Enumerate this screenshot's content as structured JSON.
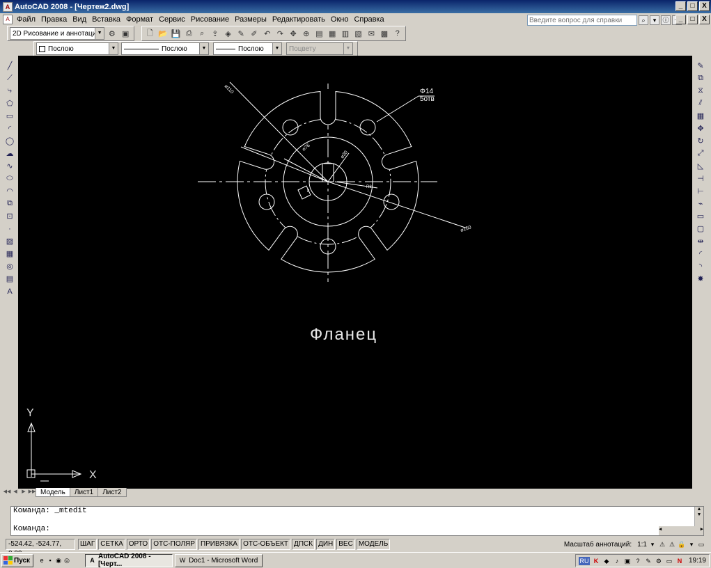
{
  "window": {
    "title": "AutoCAD 2008 - [Чертеж2.dwg]",
    "buttons": [
      "_",
      "□",
      "X"
    ],
    "doc_buttons": [
      "_",
      "□",
      "X"
    ]
  },
  "menu": [
    "Файл",
    "Правка",
    "Вид",
    "Вставка",
    "Формат",
    "Сервис",
    "Рисование",
    "Размеры",
    "Редактировать",
    "Окно",
    "Справка"
  ],
  "help": {
    "placeholder": "Введите вопрос для справки"
  },
  "workspace": {
    "value": "2D Рисование и аннотации"
  },
  "properties": {
    "color": "Послою",
    "linetype": "Послою",
    "lineweight": "Послою",
    "plotstyle": "Поцвету"
  },
  "drawing": {
    "dia_110": "⌀110",
    "hole_spec_1": "Φ14",
    "hole_spec_2": "5отв",
    "dia_76": "⌀76",
    "dia_30": "⌀30",
    "dim_r8": "R8",
    "dia_150": "⌀150",
    "dim_8": "8",
    "caption": "Фланец",
    "ucs_x": "X",
    "ucs_y": "Y"
  },
  "tabs": {
    "model": "Модель",
    "sheet1": "Лист1",
    "sheet2": "Лист2"
  },
  "command": {
    "history": "Команда:  _mtedit",
    "prompt": "Команда:"
  },
  "status": {
    "coords": "-524.42, -524.77, 0.00",
    "toggles": [
      "ШАГ",
      "СЕТКА",
      "ОРТО",
      "ОТС-ПОЛЯР",
      "ПРИВЯЗКА",
      "ОТС-ОБЪЕКТ",
      "ДПСК",
      "ДИН",
      "ВЕС",
      "МОДЕЛЬ"
    ],
    "annotation_scale_label": "Масштаб аннотаций:",
    "annotation_scale_value": "1:1"
  },
  "taskbar": {
    "start": "Пуск",
    "tasks": [
      "AutoCAD 2008 - [Черт...",
      "Doc1 - Microsoft Word"
    ],
    "lang": "RU",
    "clock": "19:19"
  },
  "colors": {
    "canvas": "#000000",
    "titlebar": "#0a246a",
    "drawing_lines": "#ffffff"
  }
}
